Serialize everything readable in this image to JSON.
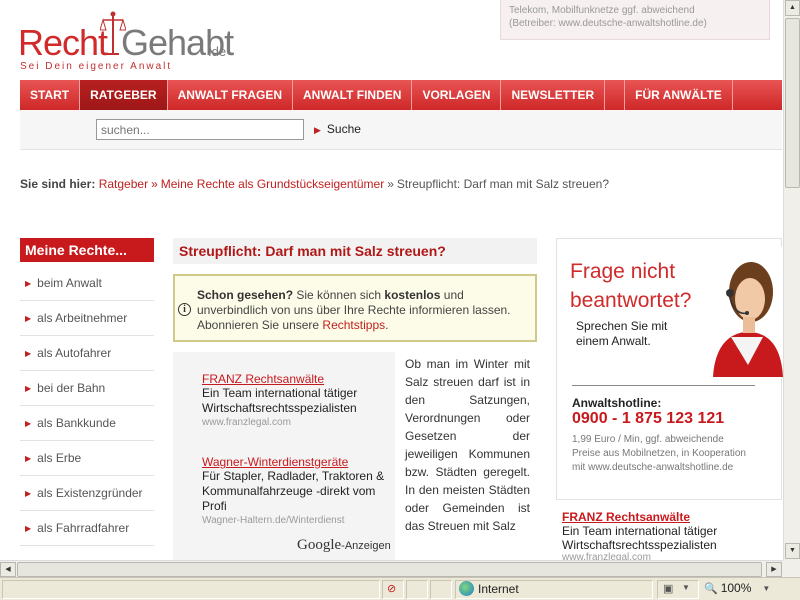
{
  "logo": {
    "word1": "Recht",
    "word2": "Gehabt",
    "tld": ".de",
    "tagline": "Sei Dein eigener Anwalt"
  },
  "hotline_top": {
    "line1": "Telekom, Mobilfunknetze ggf. abweichend",
    "line2": "(Betreiber: www.deutsche-anwaltshotline.de)"
  },
  "nav": [
    "START",
    "RATGEBER",
    "ANWALT FRAGEN",
    "ANWALT FINDEN",
    "VORLAGEN",
    "NEWSLETTER",
    "FÜR ANWÄLTE"
  ],
  "search": {
    "placeholder": "suchen...",
    "button": "Suche"
  },
  "breadcrumb": {
    "label": "Sie sind hier:",
    "links": [
      "Ratgeber",
      "Meine Rechte als Grundstückseigentümer"
    ],
    "current": "Streupflicht: Darf man mit Salz streuen?"
  },
  "sidebar": {
    "heading": "Meine Rechte...",
    "items": [
      "beim Anwalt",
      "als Arbeitnehmer",
      "als Autofahrer",
      "bei der Bahn",
      "als Bankkunde",
      "als Erbe",
      "als Existenzgründer",
      "als Fahrradfahrer"
    ]
  },
  "article_title": "Streupflicht: Darf man mit Salz streuen?",
  "notice": {
    "lead": "Schon gesehen?",
    "text1": " Sie können sich ",
    "bold": "kostenlos",
    "text2": " und unverbindlich von uns über Ihre Rechte informieren lassen. Abonnieren Sie unsere ",
    "link": "Rechtstipps",
    "end": "."
  },
  "ads": [
    {
      "title": "FRANZ Rechtsanwälte",
      "desc": "Ein Team international tätiger Wirtschaftsrechtsspezialisten",
      "url": "www.franzlegal.com"
    },
    {
      "title": "Wagner-Winterdienstgeräte",
      "desc": "Für Stapler, Radlader, Traktoren & Kommunalfahrzeuge -direkt vom Profi",
      "url": "Wagner-Haltern.de/Winterdienst"
    }
  ],
  "google_ads": {
    "brand": "Google",
    "label": "-Anzeigen"
  },
  "article_text": "Ob man im Winter mit Salz streuen darf ist in den Satzungen, Verordnungen oder Gesetzen der jeweiligen Kommunen bzw. Städten geregelt. In den meisten Städten oder Gemeinden ist das Streuen mit Salz",
  "rightbox": {
    "heading": "Frage nicht beantwortet?",
    "sub": "Sprechen Sie mit einem Anwalt.",
    "hotline_label": "Anwaltshotline:",
    "number": "0900 - 1 875 123 121",
    "fine": "1,99 Euro / Min, ggf. abweichende Preise aus Mobilnetzen, in Kooperation mit www.deutsche-anwaltshotline.de"
  },
  "right_ad": {
    "title": "FRANZ Rechtsanwälte",
    "desc": "Ein Team international tätiger Wirtschaftsrechtsspezialisten",
    "url": "www.franzlegal.com"
  },
  "statusbar": {
    "zone": "Internet",
    "zoom": "100%"
  },
  "colors": {
    "brand_red": "#c8191d",
    "nav_red": "#d83232",
    "notice_bg": "#fdfce8"
  }
}
